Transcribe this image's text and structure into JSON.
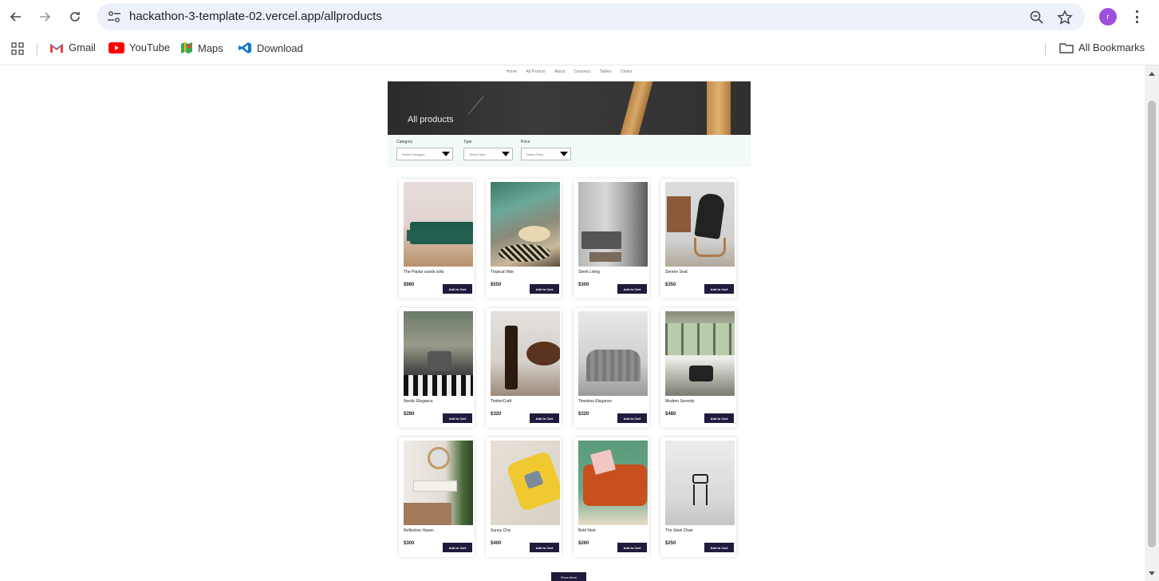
{
  "browser": {
    "url": "hackathon-3-template-02.vercel.app/allproducts",
    "profile_initial": "r",
    "bookmarks": [
      {
        "label": "Gmail",
        "icon": "gmail-icon"
      },
      {
        "label": "YouTube",
        "icon": "youtube-icon"
      },
      {
        "label": "Maps",
        "icon": "maps-icon"
      },
      {
        "label": "Download",
        "icon": "vscode-icon"
      }
    ],
    "all_bookmarks": "All Bookmarks"
  },
  "site": {
    "nav": [
      "Home",
      "All Product",
      "About",
      "Ceramics",
      "Tables",
      "Chairs"
    ],
    "hero_title": "All products",
    "filters": [
      {
        "label": "Category",
        "placeholder": "Select Category"
      },
      {
        "label": "Type",
        "placeholder": "Select Type"
      },
      {
        "label": "Price",
        "placeholder": "Select Price"
      }
    ],
    "cart_label": "Add to Cart",
    "show_more": "Show More",
    "products": [
      {
        "name": "The Poplar suede sofa",
        "price": "$980"
      },
      {
        "name": "Tropical Vibe",
        "price": "$550"
      },
      {
        "name": "Sleek Living",
        "price": "$300"
      },
      {
        "name": "Serene Seat",
        "price": "$350"
      },
      {
        "name": "Nordic Elegance",
        "price": "$280"
      },
      {
        "name": "TimberCraft",
        "price": "$320"
      },
      {
        "name": "Timeless Elegance",
        "price": "$320"
      },
      {
        "name": "Modern Serenity",
        "price": "$480"
      },
      {
        "name": "Reflective Haven",
        "price": "$300"
      },
      {
        "name": "Sunny Chic",
        "price": "$400"
      },
      {
        "name": "Bold Nest",
        "price": "$260"
      },
      {
        "name": "The Steel Chair",
        "price": "$250"
      }
    ]
  },
  "colors": {
    "button_dark": "#1f1b3d",
    "filter_bg": "#f2f9f9",
    "omnibox_bg": "#edf2fa",
    "profile": "#9d4edd"
  }
}
